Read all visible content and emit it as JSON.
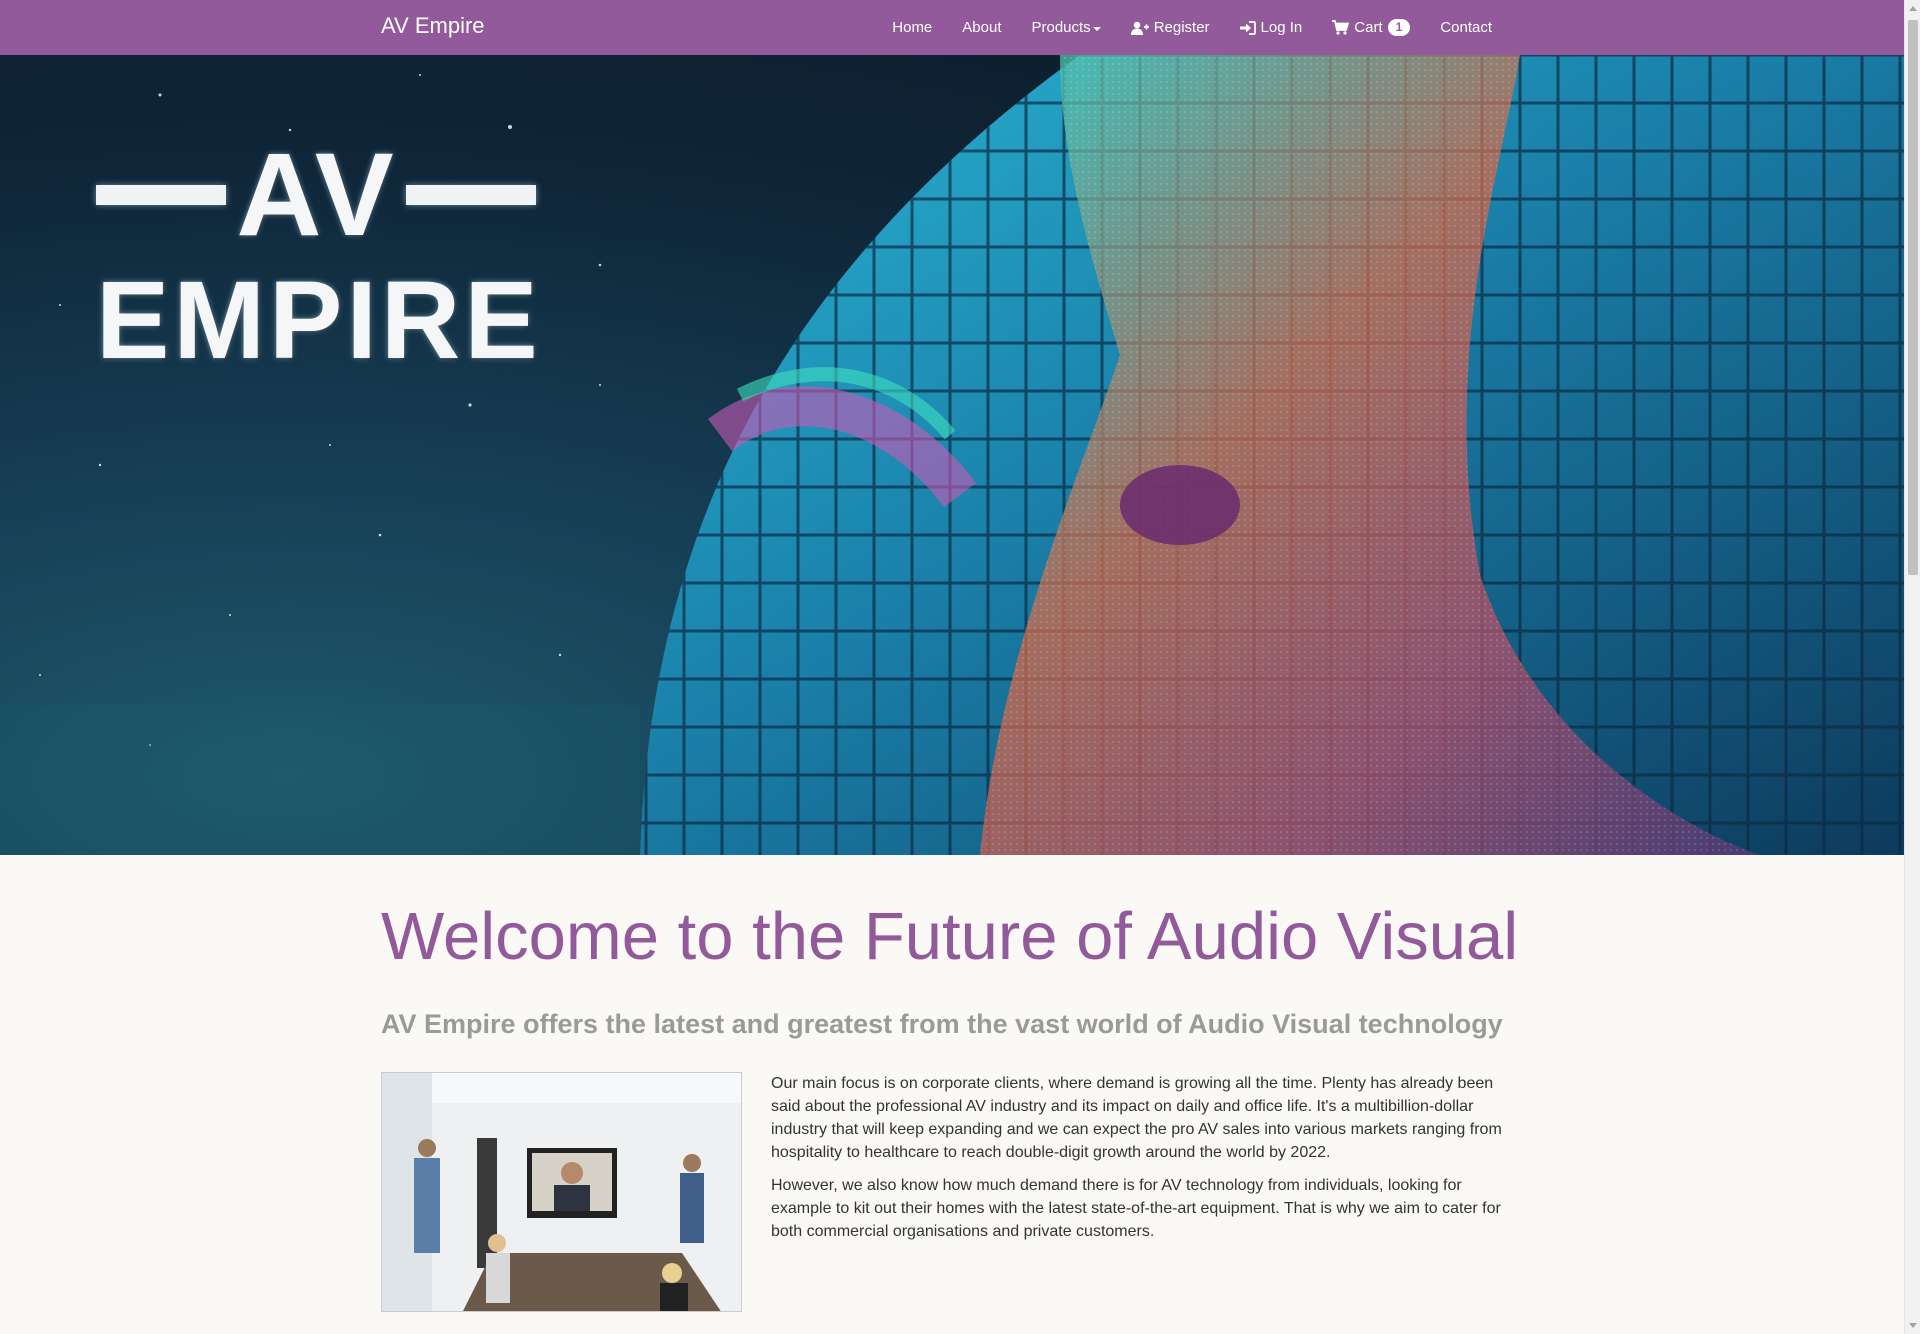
{
  "navbar": {
    "brand": "AV Empire",
    "background": "#925a9a",
    "items": [
      {
        "label": "Home",
        "icon": null
      },
      {
        "label": "About",
        "icon": null
      },
      {
        "label": "Products",
        "icon": "caret-down-icon"
      },
      {
        "label": "Register",
        "icon": "user-plus-icon"
      },
      {
        "label": "Log In",
        "icon": "sign-in-icon"
      },
      {
        "label": "Cart",
        "icon": "shopping-cart-icon",
        "badge": "1"
      },
      {
        "label": "Contact",
        "icon": null
      }
    ]
  },
  "hero": {
    "logo_top": "AV",
    "logo_bottom": "EMPIRE",
    "image": "night-building-led-facade"
  },
  "main": {
    "heading": "Welcome to the Future of Audio Visual",
    "subheading": "AV Empire offers the latest and greatest from the vast world of Audio Visual technology",
    "image": "conference-room-video-call",
    "paragraphs": [
      "Our main focus is on corporate clients, where demand is growing all the time. Plenty has already been said about the professional AV industry and its impact on daily and office life. It's a multibillion-dollar industry that will keep expanding and we can expect the pro AV sales into various markets ranging from hospitality to healthcare to reach double-digit growth around the world by 2022.",
      "However, we also know how much demand there is for AV technology from individuals, looking for example to kit out their homes with the latest state-of-the-art equipment. That is why we aim to cater for both commercial organisations and private customers."
    ]
  },
  "colors": {
    "accent": "#925a9a",
    "subheading": "#9a9a9a",
    "body_text": "#333333",
    "page_bg": "#faf9f6"
  }
}
